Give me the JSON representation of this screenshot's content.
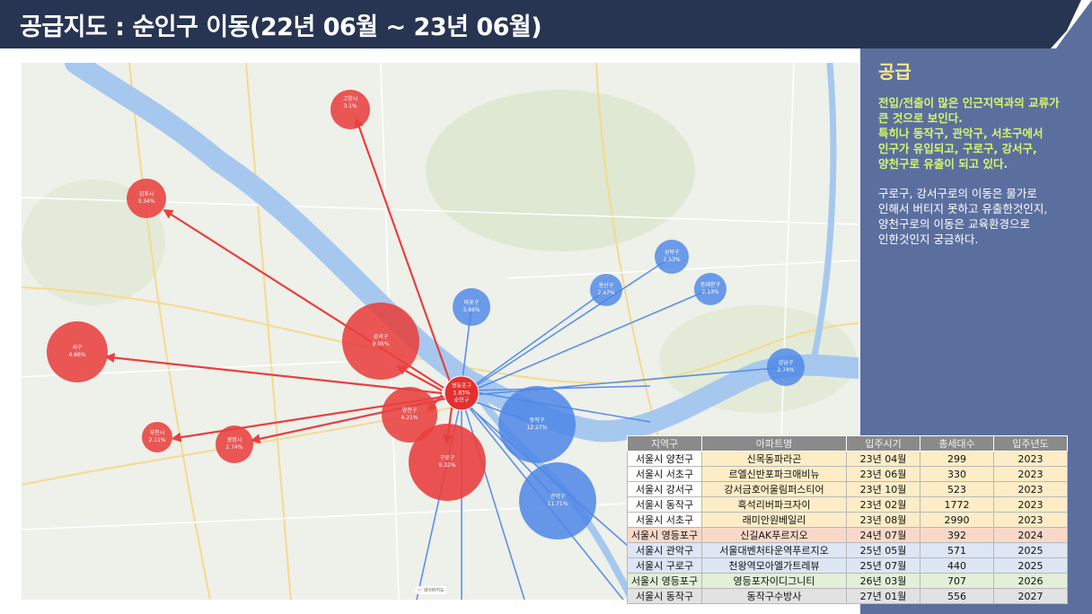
{
  "title": "공급지도 : 순인구 이동(22년 06월 ~ 23년 06월)",
  "panel": {
    "heading": "공급",
    "highlight": "전입/전출이 많은 인근지역과의 교류가\n큰 것으로 보인다.\n특히나  동작구, 관악구, 서초구에서\n인구가 유입되고, 구로구, 강서구,\n양천구로 유출이 되고 있다.",
    "body": "구로구, 강서구로의 이동은 물가로\n인해서 버티지 못하고 유출한것인지,\n양천구로의 이동은 교육환경으로\n인한것인지 궁금하다."
  },
  "map": {
    "watermark": "ⓒ 네이버지도",
    "center": {
      "name": "영등포구",
      "value": "1.83%",
      "extra": "순인구"
    },
    "outflow": [
      {
        "name": "고양시",
        "value": "3.1%"
      },
      {
        "name": "김포시",
        "value": "3.34%"
      },
      {
        "name": "강서구",
        "value": "9.05%"
      },
      {
        "name": "서구",
        "value": "4.66%"
      },
      {
        "name": "양천구",
        "value": "4.21%"
      },
      {
        "name": "부천시",
        "value": "2.11%"
      },
      {
        "name": "광명시",
        "value": "2.74%"
      },
      {
        "name": "구로구",
        "value": "9.32%"
      }
    ],
    "inflow": [
      {
        "name": "마포구",
        "value": "3.86%"
      },
      {
        "name": "용산구",
        "value": "2.47%"
      },
      {
        "name": "성북구",
        "value": "2.53%"
      },
      {
        "name": "동대문구",
        "value": "2.13%"
      },
      {
        "name": "강남구",
        "value": "2.74%"
      },
      {
        "name": "동작구",
        "value": "12.27%"
      },
      {
        "name": "관악구",
        "value": "11.71%"
      }
    ]
  },
  "table": {
    "headers": [
      "지역구",
      "아파트명",
      "입주시기",
      "총세대수",
      "입주년도"
    ],
    "rows": [
      {
        "region": "서울시 양천구",
        "apt": "신목동파라곤",
        "date": "23년 04월",
        "units": "299",
        "year": "2023"
      },
      {
        "region": "서울시 서초구",
        "apt": "르엘신반포파크애비뉴",
        "date": "23년 06월",
        "units": "330",
        "year": "2023"
      },
      {
        "region": "서울시 강서구",
        "apt": "강서금호어울림퍼스티어",
        "date": "23년 10월",
        "units": "523",
        "year": "2023"
      },
      {
        "region": "서울시 동작구",
        "apt": "흑석리버파크자이",
        "date": "23년 02월",
        "units": "1772",
        "year": "2023"
      },
      {
        "region": "서울시 서초구",
        "apt": "래미안원베일리",
        "date": "23년 08월",
        "units": "2990",
        "year": "2023"
      },
      {
        "region": "서울시 영등포구",
        "apt": "신길AK푸르지오",
        "date": "24년 07월",
        "units": "392",
        "year": "2024"
      },
      {
        "region": "서울시 관악구",
        "apt": "서울대벤처타운역푸르지오",
        "date": "25년 05월",
        "units": "571",
        "year": "2025"
      },
      {
        "region": "서울시 구로구",
        "apt": "천왕역모아엘가트레뷰",
        "date": "25년 07월",
        "units": "440",
        "year": "2025"
      },
      {
        "region": "서울시 영등포구",
        "apt": "영등포자이디그니티",
        "date": "26년 03월",
        "units": "707",
        "year": "2026"
      },
      {
        "region": "서울시 동작구",
        "apt": "동작구수방사",
        "date": "27년 01월",
        "units": "556",
        "year": "2027"
      }
    ]
  },
  "colors": {
    "title_bg": "#273552",
    "panel_bg": "#5b6f9f",
    "outflow": "#e8403f",
    "inflow": "#4d86e8",
    "river": "#a6c8ef"
  }
}
